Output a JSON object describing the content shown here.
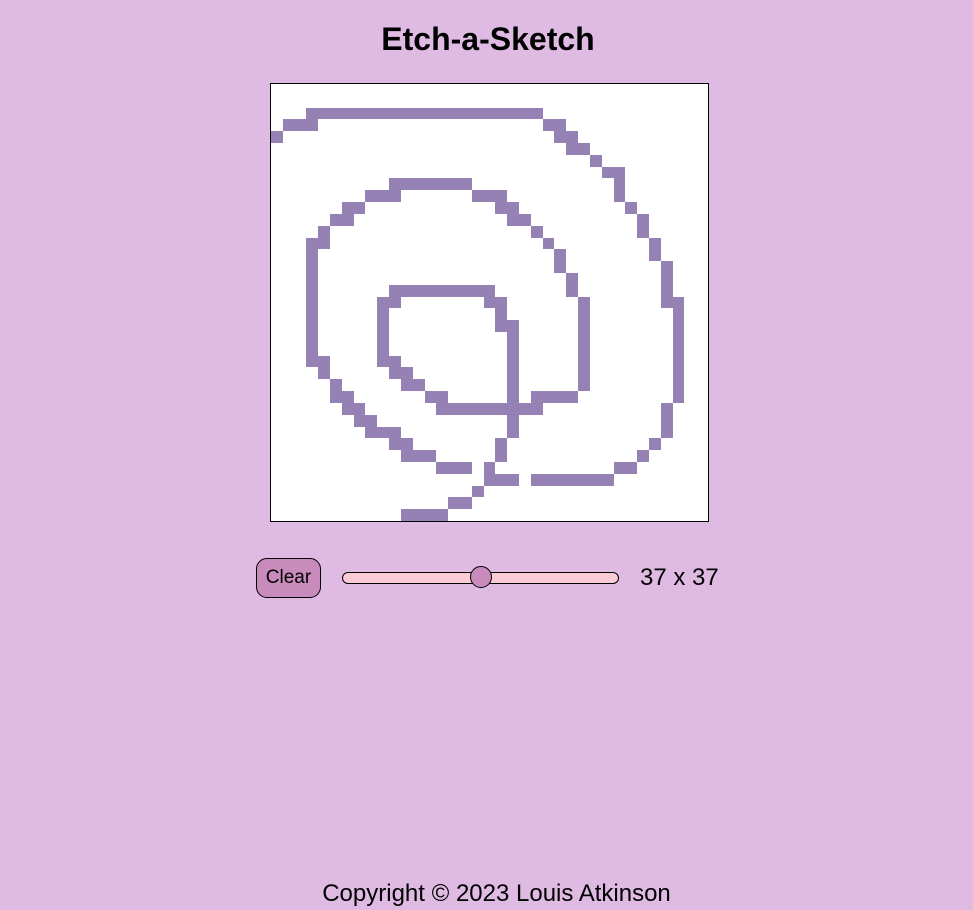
{
  "page": {
    "title": "Etch-a-Sketch",
    "footer": "Copyright © 2023 Louis Atkinson"
  },
  "controls": {
    "clear_label": "Clear",
    "size_label": "37 x 37",
    "slider_value": 37,
    "slider_min": 2,
    "slider_max": 72
  },
  "grid": {
    "columns": 37,
    "rows": 37,
    "colors": {
      "background": "#ffffff",
      "ink": "#9581b3",
      "page": "#dfbbe3",
      "button": "#c88bbb",
      "track": "#fbcbd6"
    },
    "drawn_cells": [
      [
        2,
        3
      ],
      [
        2,
        4
      ],
      [
        2,
        5
      ],
      [
        2,
        6
      ],
      [
        2,
        7
      ],
      [
        2,
        8
      ],
      [
        2,
        9
      ],
      [
        2,
        10
      ],
      [
        2,
        11
      ],
      [
        2,
        12
      ],
      [
        2,
        13
      ],
      [
        2,
        14
      ],
      [
        2,
        15
      ],
      [
        2,
        16
      ],
      [
        2,
        17
      ],
      [
        2,
        18
      ],
      [
        2,
        19
      ],
      [
        2,
        20
      ],
      [
        2,
        21
      ],
      [
        2,
        22
      ],
      [
        3,
        1
      ],
      [
        3,
        2
      ],
      [
        3,
        3
      ],
      [
        3,
        23
      ],
      [
        3,
        24
      ],
      [
        4,
        0
      ],
      [
        4,
        24
      ],
      [
        4,
        25
      ],
      [
        5,
        25
      ],
      [
        5,
        26
      ],
      [
        6,
        27
      ],
      [
        7,
        28
      ],
      [
        7,
        29
      ],
      [
        8,
        10
      ],
      [
        8,
        11
      ],
      [
        8,
        12
      ],
      [
        8,
        13
      ],
      [
        8,
        14
      ],
      [
        8,
        15
      ],
      [
        8,
        16
      ],
      [
        8,
        29
      ],
      [
        9,
        8
      ],
      [
        9,
        9
      ],
      [
        9,
        10
      ],
      [
        9,
        17
      ],
      [
        9,
        18
      ],
      [
        9,
        19
      ],
      [
        9,
        29
      ],
      [
        10,
        6
      ],
      [
        10,
        7
      ],
      [
        10,
        19
      ],
      [
        10,
        20
      ],
      [
        10,
        30
      ],
      [
        11,
        5
      ],
      [
        11,
        6
      ],
      [
        11,
        20
      ],
      [
        11,
        21
      ],
      [
        11,
        31
      ],
      [
        12,
        4
      ],
      [
        12,
        22
      ],
      [
        12,
        31
      ],
      [
        13,
        3
      ],
      [
        13,
        4
      ],
      [
        13,
        23
      ],
      [
        13,
        32
      ],
      [
        14,
        3
      ],
      [
        14,
        24
      ],
      [
        14,
        32
      ],
      [
        15,
        3
      ],
      [
        15,
        24
      ],
      [
        15,
        33
      ],
      [
        16,
        3
      ],
      [
        16,
        25
      ],
      [
        16,
        33
      ],
      [
        17,
        3
      ],
      [
        17,
        10
      ],
      [
        17,
        11
      ],
      [
        17,
        12
      ],
      [
        17,
        13
      ],
      [
        17,
        14
      ],
      [
        17,
        15
      ],
      [
        17,
        16
      ],
      [
        17,
        17
      ],
      [
        17,
        18
      ],
      [
        17,
        25
      ],
      [
        17,
        33
      ],
      [
        18,
        3
      ],
      [
        18,
        9
      ],
      [
        18,
        10
      ],
      [
        18,
        18
      ],
      [
        18,
        19
      ],
      [
        18,
        26
      ],
      [
        18,
        33
      ],
      [
        18,
        34
      ],
      [
        19,
        3
      ],
      [
        19,
        9
      ],
      [
        19,
        19
      ],
      [
        19,
        26
      ],
      [
        19,
        34
      ],
      [
        20,
        3
      ],
      [
        20,
        9
      ],
      [
        20,
        19
      ],
      [
        20,
        20
      ],
      [
        20,
        26
      ],
      [
        20,
        34
      ],
      [
        21,
        3
      ],
      [
        21,
        9
      ],
      [
        21,
        20
      ],
      [
        21,
        26
      ],
      [
        21,
        34
      ],
      [
        22,
        3
      ],
      [
        22,
        9
      ],
      [
        22,
        20
      ],
      [
        22,
        26
      ],
      [
        22,
        34
      ],
      [
        23,
        3
      ],
      [
        23,
        4
      ],
      [
        23,
        9
      ],
      [
        23,
        10
      ],
      [
        23,
        20
      ],
      [
        23,
        26
      ],
      [
        23,
        34
      ],
      [
        24,
        4
      ],
      [
        24,
        10
      ],
      [
        24,
        11
      ],
      [
        24,
        20
      ],
      [
        24,
        26
      ],
      [
        24,
        34
      ],
      [
        25,
        5
      ],
      [
        25,
        11
      ],
      [
        25,
        12
      ],
      [
        25,
        20
      ],
      [
        25,
        26
      ],
      [
        25,
        34
      ],
      [
        26,
        5
      ],
      [
        26,
        6
      ],
      [
        26,
        13
      ],
      [
        26,
        14
      ],
      [
        26,
        20
      ],
      [
        26,
        22
      ],
      [
        26,
        23
      ],
      [
        26,
        24
      ],
      [
        26,
        25
      ],
      [
        26,
        34
      ],
      [
        27,
        6
      ],
      [
        27,
        7
      ],
      [
        27,
        14
      ],
      [
        27,
        15
      ],
      [
        27,
        16
      ],
      [
        27,
        17
      ],
      [
        27,
        18
      ],
      [
        27,
        19
      ],
      [
        27,
        20
      ],
      [
        27,
        21
      ],
      [
        27,
        22
      ],
      [
        27,
        33
      ],
      [
        28,
        7
      ],
      [
        28,
        8
      ],
      [
        28,
        20
      ],
      [
        28,
        33
      ],
      [
        29,
        8
      ],
      [
        29,
        9
      ],
      [
        29,
        10
      ],
      [
        29,
        20
      ],
      [
        29,
        33
      ],
      [
        30,
        10
      ],
      [
        30,
        11
      ],
      [
        30,
        19
      ],
      [
        30,
        32
      ],
      [
        31,
        11
      ],
      [
        31,
        12
      ],
      [
        31,
        13
      ],
      [
        31,
        19
      ],
      [
        31,
        31
      ],
      [
        32,
        14
      ],
      [
        32,
        15
      ],
      [
        32,
        16
      ],
      [
        32,
        18
      ],
      [
        32,
        29
      ],
      [
        32,
        30
      ],
      [
        33,
        18
      ],
      [
        33,
        19
      ],
      [
        33,
        20
      ],
      [
        33,
        22
      ],
      [
        33,
        23
      ],
      [
        33,
        24
      ],
      [
        33,
        25
      ],
      [
        33,
        26
      ],
      [
        33,
        27
      ],
      [
        33,
        28
      ],
      [
        34,
        17
      ],
      [
        35,
        15
      ],
      [
        35,
        16
      ],
      [
        36,
        11
      ],
      [
        36,
        12
      ],
      [
        36,
        13
      ],
      [
        36,
        14
      ],
      [
        37,
        11
      ],
      [
        37,
        12
      ],
      [
        37,
        13
      ]
    ]
  }
}
